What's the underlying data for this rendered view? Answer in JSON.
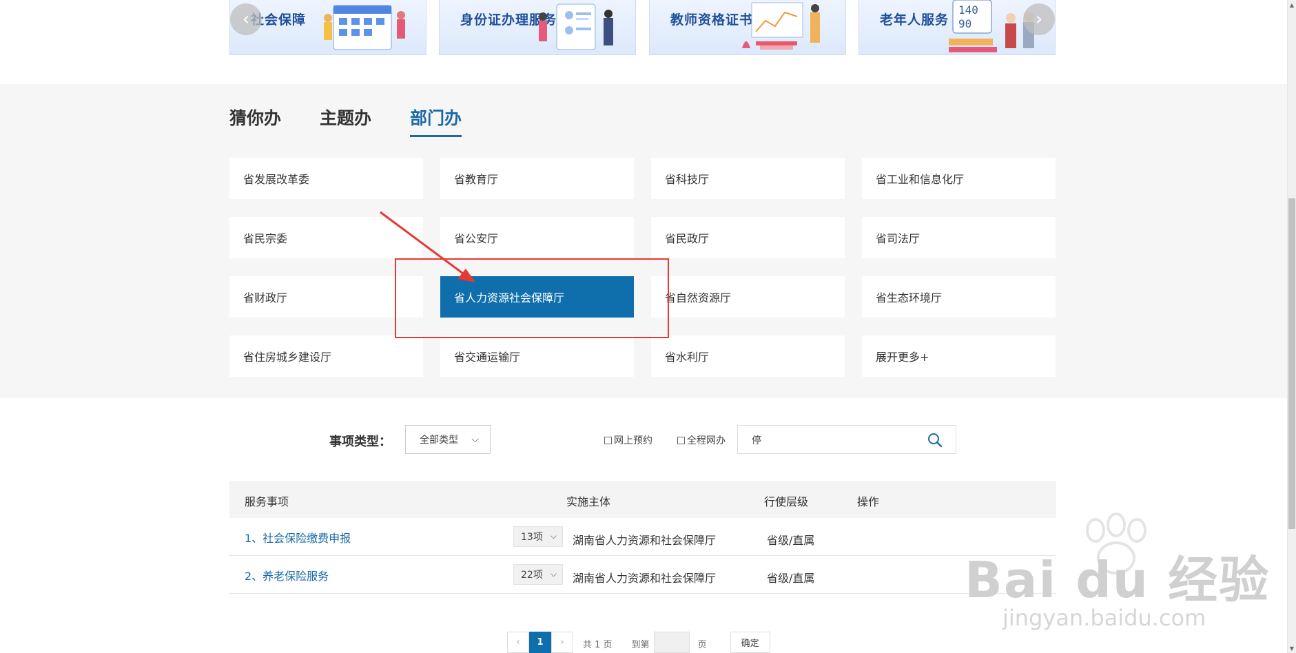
{
  "banner": {
    "cards": [
      {
        "title": "社会保障"
      },
      {
        "title": "身份证办理服务"
      },
      {
        "title": "教师资格证书服务"
      },
      {
        "title": "老年人服务"
      }
    ],
    "art_numbers": {
      "top": "140",
      "bottom": "90"
    },
    "prev_icon": "chevron-left-icon",
    "next_icon": "chevron-right-icon"
  },
  "tabs": [
    {
      "label": "猜你办",
      "active": false
    },
    {
      "label": "主题办",
      "active": false
    },
    {
      "label": "部门办",
      "active": true
    }
  ],
  "departments": [
    "省发展改革委",
    "省教育厅",
    "省科技厅",
    "省工业和信息化厅",
    "省民宗委",
    "省公安厅",
    "省民政厅",
    "省司法厅",
    "省财政厅",
    "省人力资源社会保障厅",
    "省自然资源厅",
    "省生态环境厅",
    "省住房城乡建设厅",
    "省交通运输厅",
    "省水利厅",
    "展开更多+"
  ],
  "selected_department": "省人力资源社会保障厅",
  "filter": {
    "label": "事项类型：",
    "type_select": "全部类型",
    "checkbox_online_booking": "网上预约",
    "checkbox_full_online": "全程网办",
    "search_value": "停"
  },
  "table": {
    "headers": [
      "服务事项",
      "实施主体",
      "行使层级",
      "操作"
    ],
    "rows": [
      {
        "name": "1、社会保险缴费申报",
        "count": "13项",
        "body": "湖南省人力资源和社会保障厅",
        "level": "省级/直属"
      },
      {
        "name": "2、养老保险服务",
        "count": "22项",
        "body": "湖南省人力资源和社会保障厅",
        "level": "省级/直属"
      }
    ]
  },
  "pagination": {
    "current": "1",
    "total": "共 1 页",
    "goto": "到第",
    "page_unit": "页",
    "confirm": "确定"
  },
  "watermark": {
    "brand": "Bai du 经验",
    "url": "jingyan.baidu.com"
  },
  "colors": {
    "accent": "#0f6eac",
    "annotation": "#e53935",
    "link": "#1b6aa5"
  }
}
